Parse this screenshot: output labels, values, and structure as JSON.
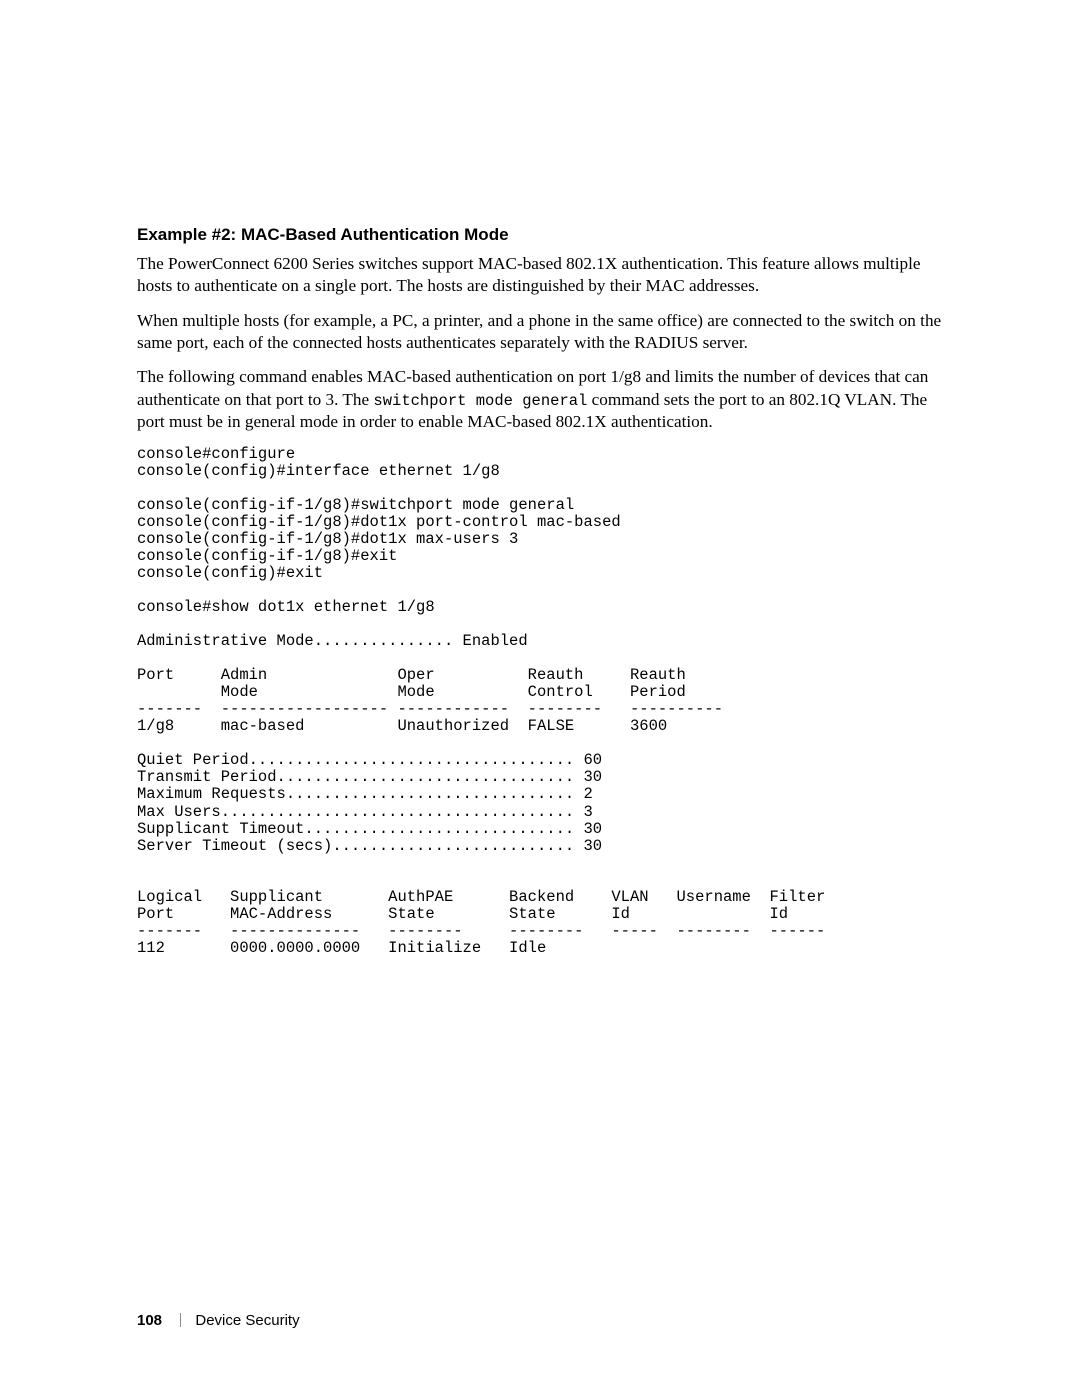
{
  "heading": "Example #2: MAC-Based Authentication Mode",
  "para1": "The PowerConnect 6200 Series switches support MAC-based 802.1X authentication. This feature allows multiple hosts to authenticate on a single port. The hosts are distinguished by their MAC addresses.",
  "para2": "When multiple hosts (for example, a PC, a printer, and a phone in the same office) are connected to the switch on the same port, each of the connected hosts authenticates separately with the RADIUS server.",
  "para3a": "The following command enables MAC-based authentication on port 1/g8 and limits the number of devices that can authenticate on that port to 3. The ",
  "para3cmd": "switchport mode general",
  "para3b": " command sets the port to an 802.1Q VLAN. The port must be in general mode in order to enable MAC-based 802.1X authentication.",
  "cli": "console#configure\nconsole(config)#interface ethernet 1/g8\n\nconsole(config-if-1/g8)#switchport mode general\nconsole(config-if-1/g8)#dot1x port-control mac-based\nconsole(config-if-1/g8)#dot1x max-users 3\nconsole(config-if-1/g8)#exit\nconsole(config)#exit\n\nconsole#show dot1x ethernet 1/g8\n\nAdministrative Mode............... Enabled\n\nPort     Admin              Oper          Reauth     Reauth\n         Mode               Mode          Control    Period\n-------  ------------------ ------------  --------   ----------\n1/g8     mac-based          Unauthorized  FALSE      3600\n\nQuiet Period................................... 60\nTransmit Period................................ 30\nMaximum Requests............................... 2\nMax Users...................................... 3\nSupplicant Timeout............................. 30\nServer Timeout (secs).......................... 30\n\n\nLogical   Supplicant       AuthPAE      Backend    VLAN   Username  Filter\nPort      MAC-Address      State        State      Id               Id\n-------   --------------   --------     --------   -----  --------  ------\n112       0000.0000.0000   Initialize   Idle",
  "footer": {
    "page": "108",
    "section": "Device Security"
  }
}
